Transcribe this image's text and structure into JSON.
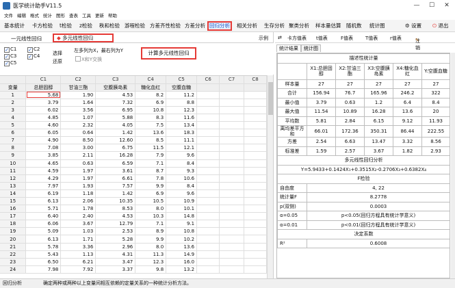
{
  "window": {
    "title": "医学统计助手V11.5",
    "minimize": "—",
    "maximize": "☐",
    "close": "✕"
  },
  "menu": [
    "文件",
    "编辑",
    "格式",
    "统计",
    "图形",
    "查表",
    "工具",
    "更新",
    "帮助"
  ],
  "toolbar": [
    "基本统计",
    "卡方检验",
    "t检验",
    "z检验",
    "秩和检验",
    "游程检验",
    "方差齐性检验",
    "方差分析",
    "回归分析",
    "相关分析",
    "生存分析",
    "聚类分析",
    "样本量估算",
    "随机数",
    "统计图"
  ],
  "toolbar_active": "回归分析",
  "toolbar_right": {
    "settings": "设置",
    "exit": "退出"
  },
  "left_tabs": {
    "simple": "一元线性回归",
    "multi": "多元线性回归",
    "example": "示例"
  },
  "checkboxes": [
    {
      "label": "C1",
      "checked": true
    },
    {
      "label": "C2",
      "checked": true
    },
    {
      "label": "C3",
      "checked": true
    },
    {
      "label": "C4",
      "checked": true
    },
    {
      "label": "C5",
      "checked": true
    }
  ],
  "actions": {
    "select": "选择",
    "restore": "还原"
  },
  "hint": "左多列为X，最右列为Y",
  "swap": "X和Y交换",
  "compute_button": "计算多元线性回归",
  "grid": {
    "col_headers": [
      "",
      "C1",
      "C2",
      "C3",
      "C4",
      "C5",
      "C6",
      "C7",
      "C8"
    ],
    "labels": [
      "变量",
      "总胆固醇",
      "甘油三酯",
      "空腹胰岛素",
      "糖化血红",
      "空腹血糖",
      "",
      "",
      ""
    ],
    "rows": [
      [
        "1",
        "5.68",
        "1.90",
        "4.53",
        "8.2",
        "11.2"
      ],
      [
        "2",
        "3.79",
        "1.64",
        "7.32",
        "6.9",
        "8.8"
      ],
      [
        "3",
        "6.02",
        "3.56",
        "6.95",
        "10.8",
        "12.3"
      ],
      [
        "4",
        "4.85",
        "1.07",
        "5.88",
        "8.3",
        "11.6"
      ],
      [
        "5",
        "4.60",
        "2.32",
        "4.05",
        "7.5",
        "13.4"
      ],
      [
        "6",
        "6.05",
        "0.64",
        "1.42",
        "13.6",
        "18.3"
      ],
      [
        "7",
        "4.90",
        "8.50",
        "12.60",
        "8.5",
        "11.1"
      ],
      [
        "8",
        "7.08",
        "3.00",
        "6.75",
        "11.5",
        "12.1"
      ],
      [
        "9",
        "3.85",
        "2.11",
        "16.28",
        "7.9",
        "9.6"
      ],
      [
        "10",
        "4.65",
        "0.63",
        "6.59",
        "7.1",
        "8.4"
      ],
      [
        "11",
        "4.59",
        "1.97",
        "3.61",
        "8.7",
        "9.3"
      ],
      [
        "12",
        "4.29",
        "1.97",
        "6.61",
        "7.8",
        "10.6"
      ],
      [
        "13",
        "7.97",
        "1.93",
        "7.57",
        "9.9",
        "8.4"
      ],
      [
        "14",
        "6.19",
        "1.18",
        "1.42",
        "6.9",
        "9.6"
      ],
      [
        "15",
        "6.13",
        "2.06",
        "10.35",
        "10.5",
        "10.9"
      ],
      [
        "16",
        "5.71",
        "1.78",
        "8.53",
        "8.0",
        "10.1"
      ],
      [
        "17",
        "6.40",
        "2.40",
        "4.53",
        "10.3",
        "14.8"
      ],
      [
        "18",
        "6.06",
        "3.67",
        "12.79",
        "7.1",
        "9.1"
      ],
      [
        "19",
        "5.09",
        "1.03",
        "2.53",
        "8.9",
        "10.8"
      ],
      [
        "20",
        "6.13",
        "1.71",
        "5.28",
        "9.9",
        "10.2"
      ],
      [
        "21",
        "5.78",
        "3.36",
        "2.96",
        "8.0",
        "13.6"
      ],
      [
        "22",
        "5.43",
        "1.13",
        "4.31",
        "11.3",
        "14.9"
      ],
      [
        "23",
        "6.50",
        "6.21",
        "3.47",
        "12.3",
        "16.0"
      ],
      [
        "24",
        "7.98",
        "7.92",
        "3.37",
        "9.8",
        "13.2"
      ]
    ]
  },
  "right_tools": [
    "⇄",
    "卡方值表",
    "t值表",
    "F值表",
    "T值表",
    "r值表",
    "注销"
  ],
  "right_tabs": [
    "统计结果",
    "统计图"
  ],
  "results": {
    "desc_title": "描述性统计量",
    "desc_headers": [
      "",
      "X1:总胆固醇",
      "X2:甘油三酯",
      "X3:空腹胰岛素",
      "X4:糖化血红",
      "Y:空腹血糖"
    ],
    "desc_rows": [
      [
        "样本量",
        "27",
        "27",
        "27",
        "27",
        "27"
      ],
      [
        "合计",
        "156.94",
        "76.7",
        "165.96",
        "246.2",
        "322"
      ],
      [
        "最小值",
        "3.79",
        "0.63",
        "1.2",
        "6.4",
        "8.4"
      ],
      [
        "最大值",
        "11.54",
        "10.89",
        "16.28",
        "13.6",
        "20"
      ],
      [
        "平均数",
        "5.81",
        "2.84",
        "6.15",
        "9.12",
        "11.93"
      ],
      [
        "离均差平方和",
        "66.01",
        "172.36",
        "350.31",
        "86.44",
        "222.55"
      ],
      [
        "方差",
        "2.54",
        "6.63",
        "13.47",
        "3.32",
        "8.56"
      ],
      [
        "标准差",
        "1.59",
        "2.57",
        "3.67",
        "1.82",
        "2.93"
      ]
    ],
    "reg_title": "多元线性回归分析",
    "equation": "Y=5.9433+0.1424X₁+0.3515X₂-0.2706X₃+0.6382X₄",
    "f_title": "F检验",
    "f_rows": [
      [
        "自由度",
        "4, 22"
      ],
      [
        "统计量F",
        "8.2778"
      ],
      [
        "p(双侧)",
        "0.0003"
      ],
      [
        "α=0.05",
        "p<0.05(回归方程具有统计学意义)"
      ],
      [
        "α=0.01",
        "p<0.01(回归方程具有统计学意义)"
      ]
    ],
    "r2_title": "决定系数",
    "r2_label": "R²",
    "r2_value": "0.6008"
  },
  "status": {
    "left": "回归分析",
    "msg": "确定两种或两种以上变量间相互依赖的定量关系的一种统计分析方法。"
  }
}
